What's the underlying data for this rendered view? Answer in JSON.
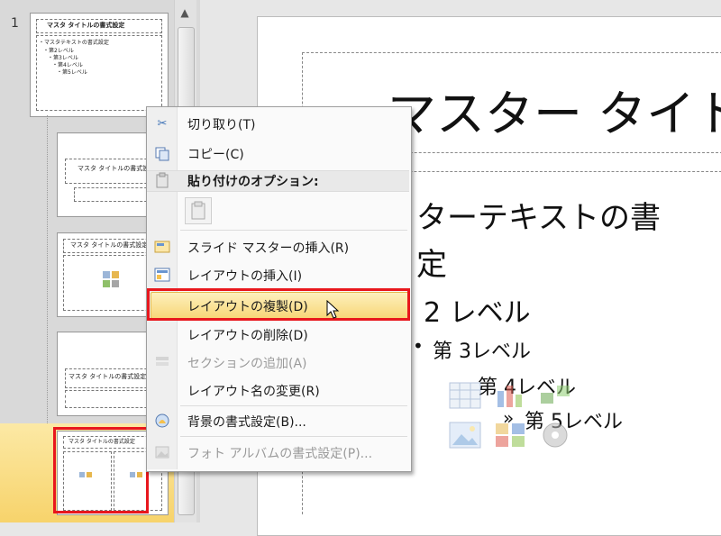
{
  "thumbnails": {
    "slide_number": "1",
    "master_title": "マスタ タイトルの書式設定",
    "master_body_lines": [
      "・マスタテキストの書式設定",
      "・第2レベル",
      "・第3レベル",
      "・第4レベル",
      "・第5レベル"
    ],
    "layout_title": "マスタ タイトルの書式設定"
  },
  "context_menu": {
    "items": [
      {
        "label": "切り取り(T)",
        "icon": "scissors-icon",
        "enabled": true
      },
      {
        "label": "コピー(C)",
        "icon": "copy-icon",
        "enabled": true
      },
      {
        "label": "貼り付けのオプション:",
        "icon": "clipboard-icon",
        "enabled": true
      },
      {
        "label": "スライド マスターの挿入(R)",
        "icon": "insert-master-icon",
        "enabled": true
      },
      {
        "label": "レイアウトの挿入(I)",
        "icon": "insert-layout-icon",
        "enabled": true
      },
      {
        "label": "レイアウトの複製(D)",
        "icon": "",
        "enabled": true
      },
      {
        "label": "レイアウトの削除(D)",
        "icon": "",
        "enabled": true
      },
      {
        "label": "セクションの追加(A)",
        "icon": "add-section-icon",
        "enabled": false
      },
      {
        "label": "レイアウト名の変更(R)",
        "icon": "",
        "enabled": true
      },
      {
        "label": "背景の書式設定(B)...",
        "icon": "background-format-icon",
        "enabled": true
      },
      {
        "label": "フォト アルバムの書式設定(P)...",
        "icon": "photo-album-icon",
        "enabled": false
      }
    ],
    "highlighted_index": 5
  },
  "main_slide": {
    "title": "マスター タイト",
    "body": {
      "level1_a": "ターテキストの書",
      "level1_b": "定",
      "level2": "2 レベル",
      "level3": "第 3レベル",
      "level4": "第 4レベル",
      "level5": "第 5レベル",
      "level5_bullet": "»",
      "level3_bullet": "•"
    }
  },
  "colors": {
    "highlight_red": "#e8171d",
    "selection_yellow": "#f8d778"
  }
}
